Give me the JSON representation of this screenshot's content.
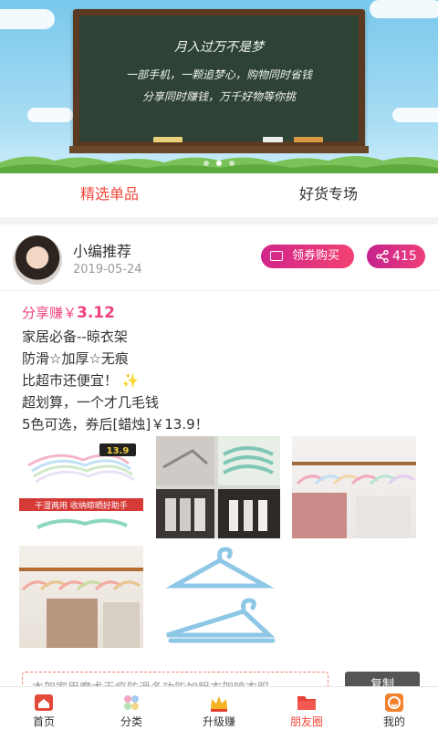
{
  "banner": {
    "line1": "月入过万不是梦",
    "line2": "一部手机，一颗追梦心，购物同时省钱",
    "line3": "分享同时赚钱，万千好物等你挑",
    "active_dot": 1,
    "dots": 3
  },
  "tabs": [
    {
      "label": "精选单品",
      "active": true
    },
    {
      "label": "好货专场",
      "active": false
    }
  ],
  "post": {
    "author": "小编推荐",
    "date": "2019-05-24",
    "coupon_button": "领券购买",
    "share_count": "415",
    "earn_label": "分享赚￥",
    "earn_amount": "3.12",
    "lines": [
      "家居必备--晾衣架",
      "防滑☆加厚☆无痕",
      "比超市还便宜！",
      "超划算，一个才几毛钱",
      "5色可选，券后[蜡烛]￥13.9！"
    ],
    "sparkle": "✨",
    "photo1_price_tag": "13.9",
    "photo1_caption": "干湿两用 收纳晾晒好助手",
    "promo_text": "本架家用魔术无痕防滑多功能加粗衣架晾衣服",
    "copy_button": "复制"
  },
  "nav": [
    {
      "label": "首页",
      "icon": "home-icon",
      "active": false
    },
    {
      "label": "分类",
      "icon": "category-icon",
      "active": false
    },
    {
      "label": "升级赚",
      "icon": "crown-icon",
      "active": false
    },
    {
      "label": "朋友圈",
      "icon": "folder-icon",
      "active": true
    },
    {
      "label": "我的",
      "icon": "profile-icon",
      "active": false
    }
  ],
  "colors": {
    "accent": "#f04a3c",
    "pink": "#f0427f",
    "coupon_gradient_start": "#d1258c",
    "coupon_gradient_end": "#f24272"
  }
}
